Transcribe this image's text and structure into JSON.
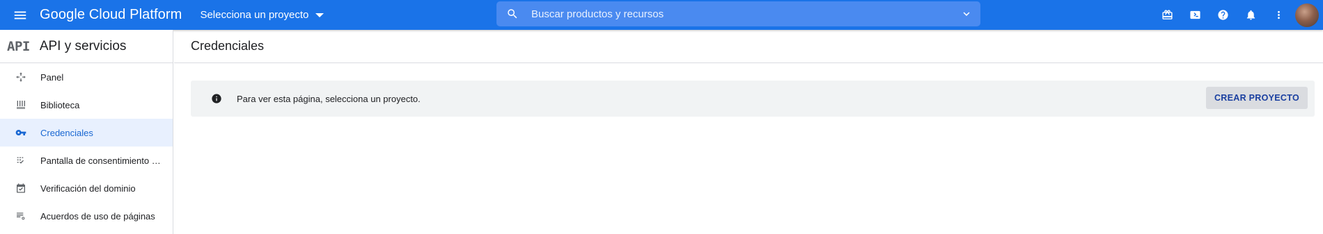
{
  "topbar": {
    "brand": "Google Cloud Platform",
    "project_picker_label": "Selecciona un proyecto",
    "search_placeholder": "Buscar productos y recursos",
    "colors": {
      "bar": "#1a73e8",
      "search_bg": "#4a8af0"
    },
    "actions": [
      "gift-icon",
      "cloud-shell-icon",
      "help-icon",
      "notifications-icon",
      "more-vert-icon"
    ]
  },
  "sidebar": {
    "logo": "API",
    "title": "API y servicios",
    "items": [
      {
        "label": "Panel",
        "icon": "dashboard-icon",
        "active": false
      },
      {
        "label": "Biblioteca",
        "icon": "library-icon",
        "active": false
      },
      {
        "label": "Credenciales",
        "icon": "key-icon",
        "active": true
      },
      {
        "label": "Pantalla de consentimiento de OAuth",
        "icon": "consent-icon",
        "active": false
      },
      {
        "label": "Verificación del dominio",
        "icon": "domain-check-icon",
        "active": false
      },
      {
        "label": "Acuerdos de uso de páginas",
        "icon": "page-settings-icon",
        "active": false
      }
    ]
  },
  "main": {
    "title": "Credenciales",
    "notice_text": "Para ver esta página, selecciona un proyecto.",
    "create_button_label": "CREAR PROYECTO"
  }
}
